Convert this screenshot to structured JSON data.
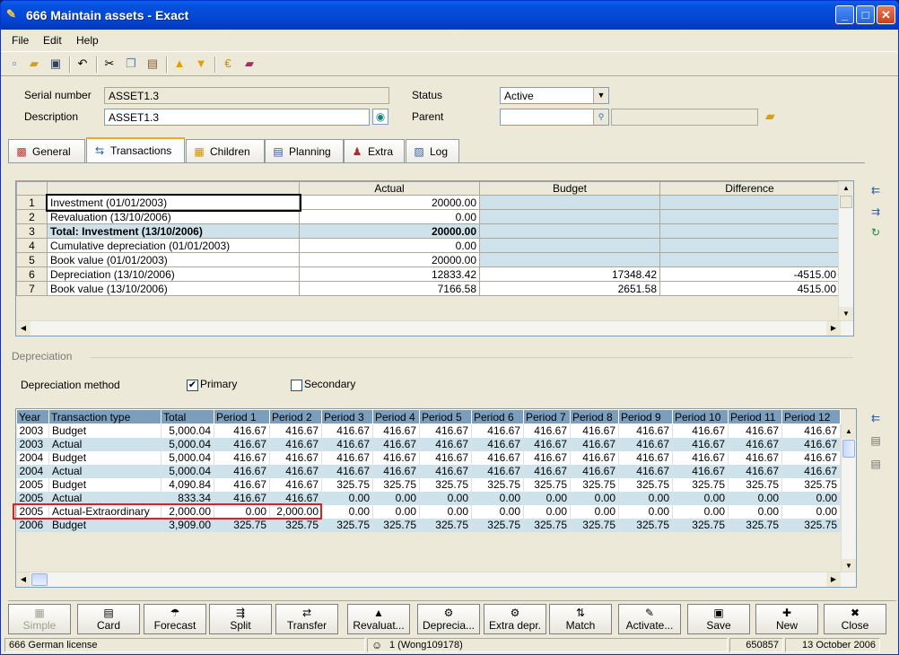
{
  "window": {
    "title": "666 Maintain assets - Exact"
  },
  "menu": [
    "File",
    "Edit",
    "Help"
  ],
  "form": {
    "serial_label": "Serial number",
    "serial_value": "ASSET1.3",
    "desc_label": "Description",
    "desc_value": "ASSET1.3",
    "status_label": "Status",
    "status_value": "Active",
    "parent_label": "Parent",
    "parent_value": ""
  },
  "tabs": [
    "General",
    "Transactions",
    "Children",
    "Planning",
    "Extra",
    "Log"
  ],
  "summary": {
    "headers": [
      "Actual",
      "Budget",
      "Difference"
    ],
    "rows": [
      {
        "n": "1",
        "label": "Investment (01/01/2003)",
        "actual": "20000.00",
        "budget": "",
        "diff": ""
      },
      {
        "n": "2",
        "label": "Revaluation (13/10/2006)",
        "actual": "0.00",
        "budget": "",
        "diff": ""
      },
      {
        "n": "3",
        "label": "Total: Investment (13/10/2006)",
        "actual": "20000.00",
        "budget": "",
        "diff": ""
      },
      {
        "n": "4",
        "label": "Cumulative depreciation (01/01/2003)",
        "actual": "0.00",
        "budget": "",
        "diff": ""
      },
      {
        "n": "5",
        "label": "Book value (01/01/2003)",
        "actual": "20000.00",
        "budget": "",
        "diff": ""
      },
      {
        "n": "6",
        "label": "Depreciation (13/10/2006)",
        "actual": "12833.42",
        "budget": "17348.42",
        "diff": "-4515.00"
      },
      {
        "n": "7",
        "label": "Book value (13/10/2006)",
        "actual": "7166.58",
        "budget": "2651.58",
        "diff": "4515.00"
      }
    ]
  },
  "depreciation": {
    "section_label": "Depreciation",
    "method_label": "Depreciation method",
    "primary_label": "Primary",
    "primary_checked": "✔",
    "secondary_label": "Secondary"
  },
  "grid": {
    "headers": [
      "Year",
      "Transaction type",
      "Total",
      "Period 1",
      "Period 2",
      "Period 3",
      "Period 4",
      "Period 5",
      "Period 6",
      "Period 7",
      "Period 8",
      "Period 9",
      "Period 10",
      "Period 11",
      "Period 12"
    ],
    "rows": [
      [
        "2003",
        "Budget",
        "5,000.04",
        "416.67",
        "416.67",
        "416.67",
        "416.67",
        "416.67",
        "416.67",
        "416.67",
        "416.67",
        "416.67",
        "416.67",
        "416.67",
        "416.67"
      ],
      [
        "2003",
        "Actual",
        "5,000.04",
        "416.67",
        "416.67",
        "416.67",
        "416.67",
        "416.67",
        "416.67",
        "416.67",
        "416.67",
        "416.67",
        "416.67",
        "416.67",
        "416.67"
      ],
      [
        "2004",
        "Budget",
        "5,000.04",
        "416.67",
        "416.67",
        "416.67",
        "416.67",
        "416.67",
        "416.67",
        "416.67",
        "416.67",
        "416.67",
        "416.67",
        "416.67",
        "416.67"
      ],
      [
        "2004",
        "Actual",
        "5,000.04",
        "416.67",
        "416.67",
        "416.67",
        "416.67",
        "416.67",
        "416.67",
        "416.67",
        "416.67",
        "416.67",
        "416.67",
        "416.67",
        "416.67"
      ],
      [
        "2005",
        "Budget",
        "4,090.84",
        "416.67",
        "416.67",
        "325.75",
        "325.75",
        "325.75",
        "325.75",
        "325.75",
        "325.75",
        "325.75",
        "325.75",
        "325.75",
        "325.75"
      ],
      [
        "2005",
        "Actual",
        "833.34",
        "416.67",
        "416.67",
        "0.00",
        "0.00",
        "0.00",
        "0.00",
        "0.00",
        "0.00",
        "0.00",
        "0.00",
        "0.00",
        "0.00"
      ],
      [
        "2005",
        "Actual-Extraordinary",
        "2,000.00",
        "0.00",
        "2,000.00",
        "0.00",
        "0.00",
        "0.00",
        "0.00",
        "0.00",
        "0.00",
        "0.00",
        "0.00",
        "0.00",
        "0.00"
      ],
      [
        "2006",
        "Budget",
        "3,909.00",
        "325.75",
        "325.75",
        "325.75",
        "325.75",
        "325.75",
        "325.75",
        "325.75",
        "325.75",
        "325.75",
        "325.75",
        "325.75",
        "325.75"
      ]
    ]
  },
  "buttons": [
    {
      "label": "Simple",
      "icon": "simple-icon",
      "glyph": "▦",
      "disabled": true
    },
    {
      "label": "Card",
      "icon": "card-icon",
      "glyph": "▤",
      "disabled": false
    },
    {
      "label": "Forecast",
      "icon": "forecast-icon",
      "glyph": "☂",
      "disabled": false
    },
    {
      "label": "Split",
      "icon": "split-icon",
      "glyph": "⇶",
      "disabled": false
    },
    {
      "label": "Transfer",
      "icon": "transfer-icon",
      "glyph": "⇄",
      "disabled": false
    },
    {
      "label": "Revaluat...",
      "icon": "revaluation-icon",
      "glyph": "▲",
      "disabled": false
    },
    {
      "label": "Deprecia...",
      "icon": "depreciation-icon",
      "glyph": "⚙",
      "disabled": false
    },
    {
      "label": "Extra depr.",
      "icon": "extra-depreciation-icon",
      "glyph": "⚙",
      "disabled": false
    },
    {
      "label": "Match",
      "icon": "match-icon",
      "glyph": "⇅",
      "disabled": false
    },
    {
      "label": "Activate...",
      "icon": "activate-icon",
      "glyph": "✎",
      "disabled": false
    },
    {
      "label": "Save",
      "icon": "save-icon",
      "glyph": "▣",
      "disabled": false
    },
    {
      "label": "New",
      "icon": "new-icon",
      "glyph": "✚",
      "disabled": false
    },
    {
      "label": "Close",
      "icon": "close-icon",
      "glyph": "✖",
      "disabled": false
    }
  ],
  "status": {
    "license": "666 German license",
    "user": "1 (Wong109178)",
    "code": "650857",
    "date": "13 October 2006"
  },
  "colors": {
    "accent": "#0550de",
    "grid_header": "#7b9ebd",
    "row_alt": "#cde2ea",
    "highlight": "#e02020"
  }
}
